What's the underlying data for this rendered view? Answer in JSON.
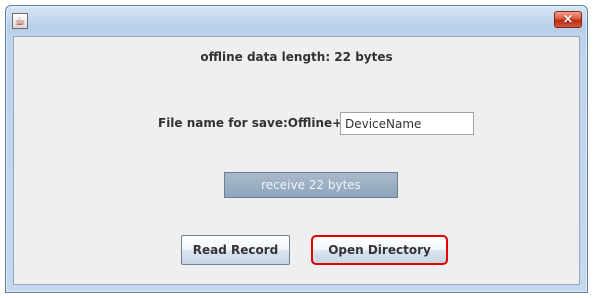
{
  "window": {
    "app_icon": "java-cup-icon",
    "close_glyph": "×"
  },
  "status": {
    "data_length_text": "offline data length: 22 bytes"
  },
  "filename": {
    "label": "File name for save:Offline+",
    "value": "DeviceName"
  },
  "receive": {
    "label": "receive 22 bytes"
  },
  "actions": {
    "read_record_label": "Read Record",
    "open_directory_label": "Open Directory"
  },
  "colors": {
    "highlight_border": "#e00000",
    "disabled_button": "#9fb2c6"
  }
}
